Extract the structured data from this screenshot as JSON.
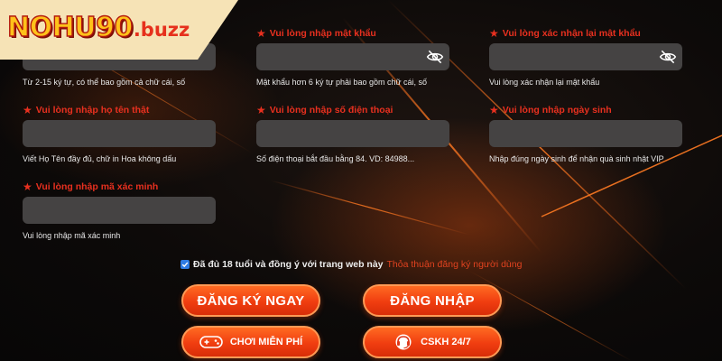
{
  "brand": {
    "logo_main": "NOHU90",
    "logo_suffix": ".buzz"
  },
  "fields": [
    {
      "label": "",
      "value": "",
      "hint": "Từ 2-15 ký tự, có thể bao gồm cả chữ cái, số"
    },
    {
      "label": "Vui lòng nhập mật khẩu",
      "value": "",
      "hint": "Mật khẩu hơn 6 ký tự phải bao gồm chữ cái, số"
    },
    {
      "label": "Vui lòng xác nhận lại mật khẩu",
      "value": "",
      "hint": "Vui lòng xác nhận lại mật khẩu"
    },
    {
      "label": "Vui lòng nhập họ tên thật",
      "value": "",
      "hint": "Viết Họ Tên đầy đủ, chữ in Hoa không dấu"
    },
    {
      "label": "Vui lòng nhập số điện thoại",
      "value": "",
      "hint": "Số điện thoại bắt đầu bằng 84. VD: 84988..."
    },
    {
      "label": "Vui lòng nhập ngày sinh",
      "value": "",
      "hint": "Nhập đúng ngày sinh để nhận quà sinh nhật VIP"
    },
    {
      "label": "Vui lòng nhập mã xác minh",
      "value": "",
      "hint": "Vui lòng nhập mã xác minh"
    }
  ],
  "agreement": {
    "checked": true,
    "text": "Đã đủ 18 tuổi và đồng ý với trang web này",
    "link": "Thỏa thuận đăng ký người dùng"
  },
  "buttons": {
    "register": "ĐĂNG KÝ NGAY",
    "login": "ĐĂNG NHẬP",
    "free_play": "CHƠI MIỄN PHÍ",
    "support": "CSKH 24/7"
  },
  "icons": {
    "required": "star-icon",
    "password_toggle": "eye-slash-icon",
    "free_play": "gamepad-icon",
    "support": "headset-icon"
  },
  "colors": {
    "label_red": "#e8301f",
    "input_bg": "#454343",
    "button_orange": "#f03d10",
    "logo_gold": "#ffc21a",
    "banner_cream": "#f6e3b6"
  }
}
